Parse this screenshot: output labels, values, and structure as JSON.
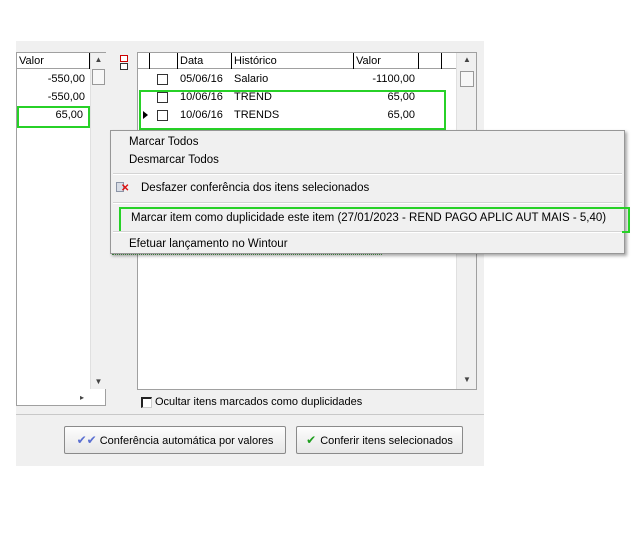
{
  "left_table": {
    "header": {
      "valor": "Valor"
    },
    "rows": [
      {
        "valor": "-550,00"
      },
      {
        "valor": "-550,00"
      },
      {
        "valor": "65,00"
      }
    ]
  },
  "right_table": {
    "headers": {
      "data": "Data",
      "historico": "Histórico",
      "valor": "Valor"
    },
    "rows": [
      {
        "data": "05/06/16",
        "historico": "Salario",
        "valor": "-1100,00"
      },
      {
        "data": "10/06/16",
        "historico": "TREND",
        "valor": "65,00"
      },
      {
        "data": "10/06/16",
        "historico": "TRENDS",
        "valor": "65,00"
      }
    ]
  },
  "context_menu": {
    "mark_all": "Marcar Todos",
    "unmark_all": "Desmarcar Todos",
    "undo_check": "Desfazer conferência dos itens selecionados",
    "mark_duplicate": "Marcar item como duplicidade este item (27/01/2023 - REND PAGO APLIC AUT MAIS - 5,40)",
    "post_wintour": "Efetuar lançamento no Wintour"
  },
  "hide_duplicates_label": "Ocultar itens marcados como duplicidades",
  "buttons": {
    "auto_check": "Conferência automática por valores",
    "check_selected": "Conferir itens selecionados"
  },
  "colors": {
    "highlight": "#27d127",
    "check_green": "#1e9e1e"
  },
  "icons": {
    "undo": "undo-check-icon",
    "check": "checkmark-icon",
    "auto": "double-check-icon"
  }
}
